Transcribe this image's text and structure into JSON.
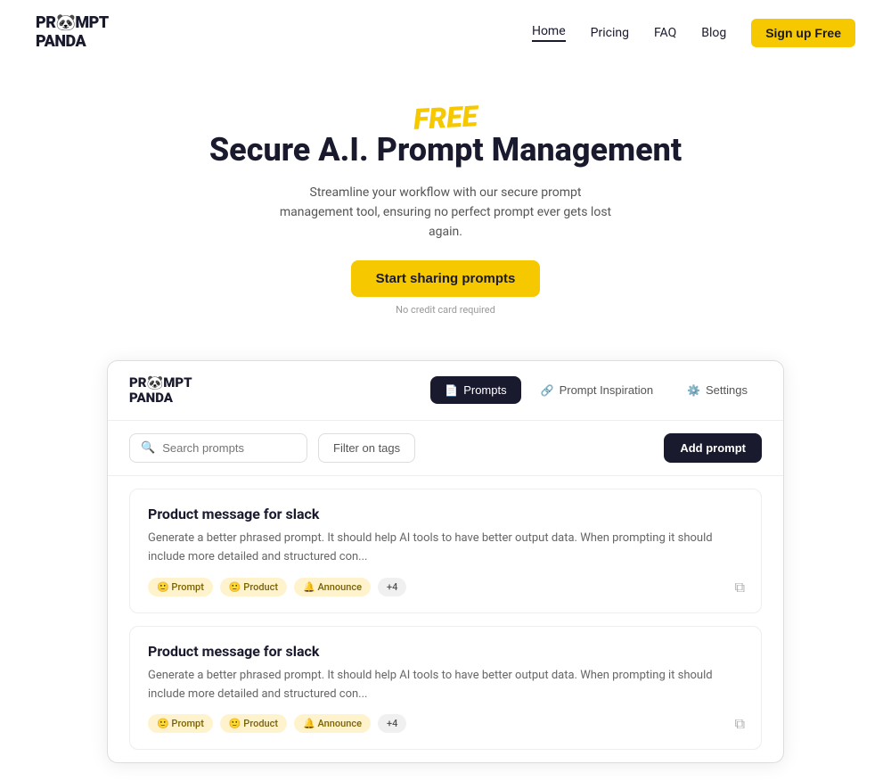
{
  "nav": {
    "logo_line1": "PR🐼MPT",
    "logo_line2": "PANDA",
    "links": [
      {
        "label": "Home",
        "active": true
      },
      {
        "label": "Pricing",
        "active": false
      },
      {
        "label": "FAQ",
        "active": false
      },
      {
        "label": "Blog",
        "active": false
      }
    ],
    "signup_label": "Sign up Free"
  },
  "hero": {
    "free_label": "FREE",
    "title": "Secure A.I. Prompt Management",
    "subtitle": "Streamline your workflow with our secure prompt management tool, ensuring no perfect prompt ever gets lost again.",
    "cta_label": "Start sharing prompts",
    "no_credit": "No credit card required"
  },
  "app": {
    "logo_line1": "PR🐼MPT",
    "logo_line2": "PANDA",
    "tabs": [
      {
        "label": "Prompts",
        "active": true,
        "icon": "📄"
      },
      {
        "label": "Prompt Inspiration",
        "active": false,
        "icon": "🔗"
      },
      {
        "label": "Settings",
        "active": false,
        "icon": "⚙️"
      }
    ],
    "search_placeholder": "Search prompts",
    "filter_label": "Filter on tags",
    "add_prompt_label": "Add prompt",
    "cards": [
      {
        "title": "Product message for slack",
        "body": "Generate a better phrased prompt. It should help AI tools to have better output data. When prompting  it should include more detailed and structured con...",
        "tags": [
          {
            "label": "🙂 Prompt",
            "type": "prompt"
          },
          {
            "label": "🙂 Product",
            "type": "product"
          },
          {
            "label": "🔔 Announce",
            "type": "announce"
          },
          {
            "label": "+4",
            "type": "more"
          }
        ]
      },
      {
        "title": "Product message for slack",
        "body": "Generate a better phrased prompt. It should help AI tools to have better output data. When prompting  it should include more detailed and structured con...",
        "tags": [
          {
            "label": "🙂 Prompt",
            "type": "prompt"
          },
          {
            "label": "🙂 Product",
            "type": "product"
          },
          {
            "label": "🔔 Announce",
            "type": "announce"
          },
          {
            "label": "+4",
            "type": "more"
          }
        ]
      }
    ]
  }
}
